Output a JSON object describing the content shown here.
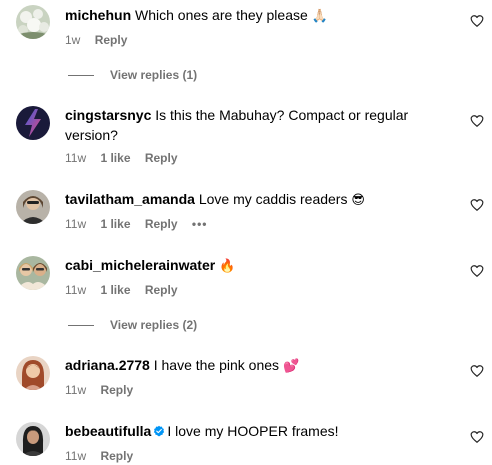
{
  "comments": [
    {
      "username": "michehun",
      "text": "Which ones are they please",
      "emoji": "🙏🏻",
      "time": "1w",
      "likes": "",
      "reply_label": "Reply",
      "avatar_icon": "white-flowers-photo",
      "view_replies": "View replies (1)"
    },
    {
      "username": "cingstarsnyc",
      "text": "Is this the Mabuhay? Compact or regular version?",
      "emoji": "",
      "time": "11w",
      "likes": "1 like",
      "reply_label": "Reply",
      "avatar_icon": "lightning-bolt-logo"
    },
    {
      "username": "tavilatham_amanda",
      "text": "Love my caddis readers",
      "emoji": "😎",
      "time": "11w",
      "likes": "1 like",
      "reply_label": "Reply",
      "more_label": "•••",
      "avatar_icon": "person-photo"
    },
    {
      "username": "cabi_michelerainwater",
      "text": "",
      "emoji": "🔥",
      "time": "11w",
      "likes": "1 like",
      "reply_label": "Reply",
      "avatar_icon": "group-photo",
      "view_replies": "View replies (2)"
    },
    {
      "username": "adriana.2778",
      "text": "I have the pink ones",
      "emoji": "💕",
      "time": "11w",
      "likes": "",
      "reply_label": "Reply",
      "avatar_icon": "person-photo"
    },
    {
      "username": "bebeautifulla",
      "text": "I love my HOOPER frames!",
      "emoji": "",
      "verified": true,
      "time": "11w",
      "likes": "",
      "reply_label": "Reply",
      "avatar_icon": "person-photo"
    }
  ],
  "colors": {
    "meta_text": "#737373",
    "verified_badge": "#0095f6",
    "background": "#ffffff"
  },
  "icons": {
    "like": "heart-outline-icon",
    "verified": "verified-badge-icon"
  }
}
